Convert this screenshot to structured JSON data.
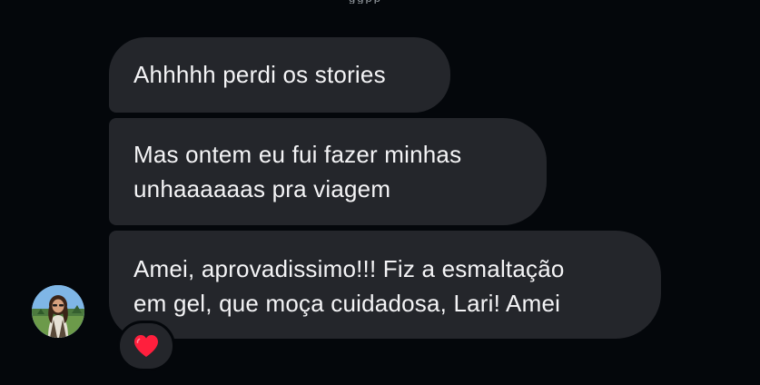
{
  "chat": {
    "top_cutoff_text": "ggpp",
    "messages": [
      {
        "lines": [
          "Ahhhhh perdi os stories"
        ]
      },
      {
        "lines": [
          "Mas ontem eu fui fazer minhas",
          "unhaaaaaas pra viagem"
        ]
      },
      {
        "lines": [
          "Amei, aprovadissimo!!! Fiz a esmaltação",
          "em gel, que moça cuidadosa, Lari! Amei"
        ]
      }
    ],
    "reaction": {
      "icon": "heart-icon",
      "color": "#ff1f3d"
    },
    "avatar": {
      "icon": "user-avatar"
    }
  },
  "colors": {
    "background": "#04070b",
    "bubble": "#24262b",
    "text": "#f4f4f6"
  }
}
